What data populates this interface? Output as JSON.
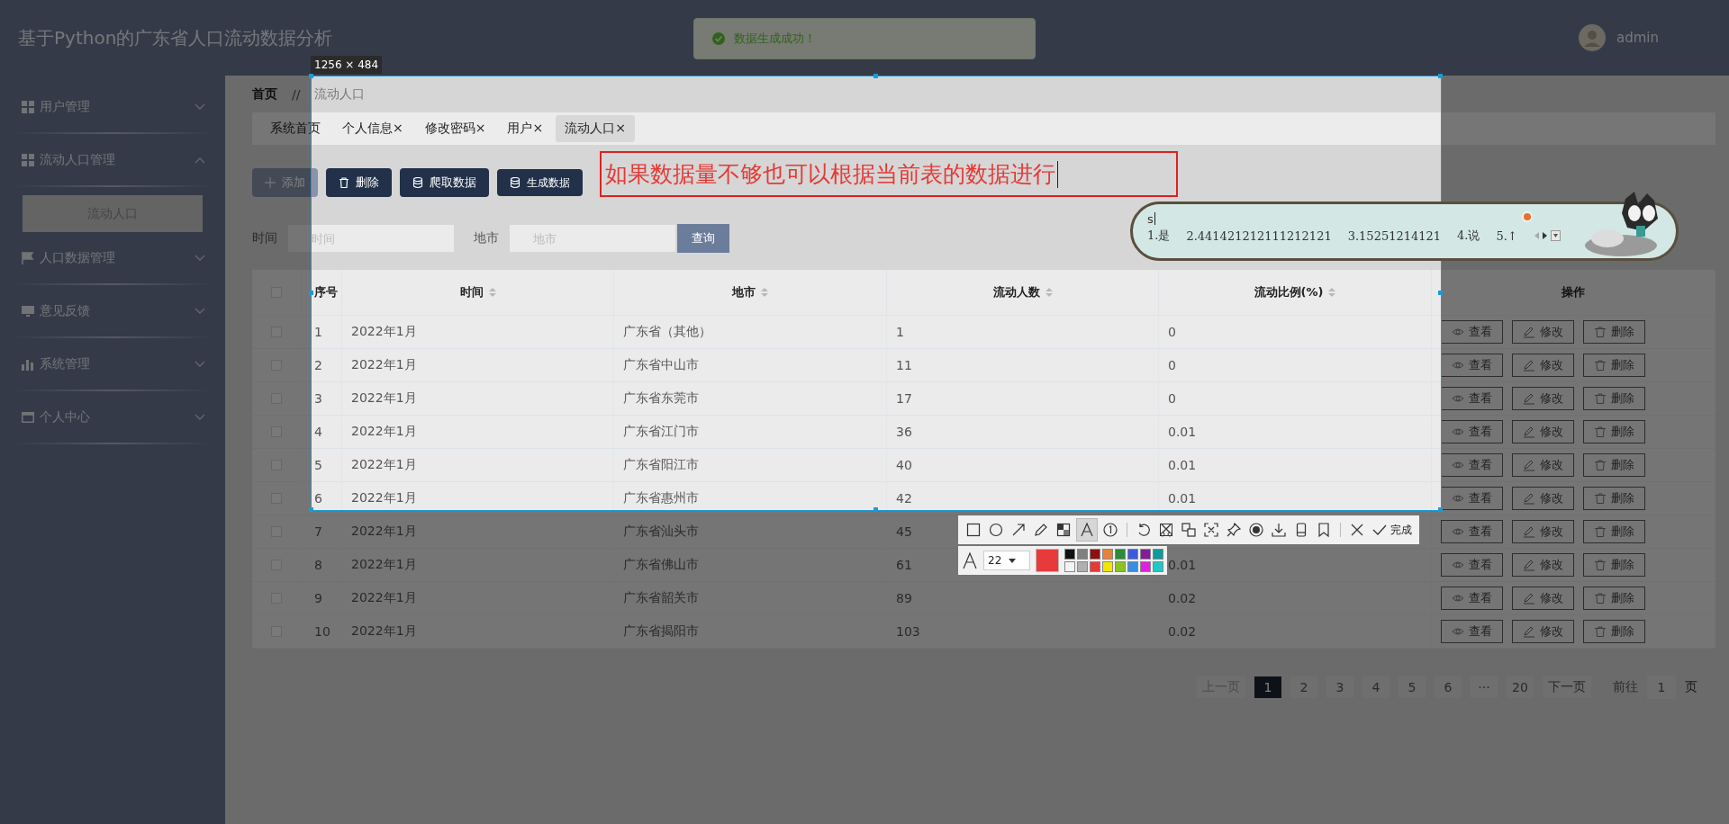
{
  "app_title": "基于Python的广东省人口流动数据分析",
  "user": {
    "name": "admin"
  },
  "toast": {
    "message": "数据生成成功！"
  },
  "sidebar": {
    "items": [
      {
        "label": "用户管理",
        "kind": "grid",
        "expanded": false
      },
      {
        "label": "流动人口管理",
        "kind": "grid",
        "expanded": true,
        "children": [
          {
            "label": "流动人口",
            "selected": true
          }
        ]
      },
      {
        "label": "人口数据管理",
        "kind": "flag",
        "expanded": false
      },
      {
        "label": "意见反馈",
        "kind": "monitor",
        "expanded": false
      },
      {
        "label": "系统管理",
        "kind": "chart",
        "expanded": false
      },
      {
        "label": "个人中心",
        "kind": "card",
        "expanded": false
      }
    ]
  },
  "breadcrumb": [
    "首页",
    "流动人口"
  ],
  "breadcrumb_separator": "//",
  "tabs": [
    {
      "label": "系统首页",
      "selected": false
    },
    {
      "label": "个人信息",
      "close": "×",
      "selected": false
    },
    {
      "label": "修改密码",
      "close": "×",
      "selected": false
    },
    {
      "label": "用户",
      "close": "×",
      "selected": false
    },
    {
      "label": "流动人口",
      "close": "×",
      "selected": true
    }
  ],
  "toolbar_buttons": [
    {
      "label": "添加",
      "kind": "add",
      "disabled": true
    },
    {
      "label": "删除",
      "kind": "delete",
      "disabled": false
    },
    {
      "label": "爬取数据",
      "kind": "database",
      "disabled": false
    },
    {
      "label": "生成数据",
      "kind": "database",
      "disabled": false
    }
  ],
  "filters": [
    {
      "label": "时间",
      "placeholder": "时间"
    },
    {
      "label": "地市",
      "placeholder": "地市"
    }
  ],
  "search_button": "查询",
  "table": {
    "columns": [
      {
        "label": "序号",
        "sortable": false
      },
      {
        "label": "时间",
        "sortable": true
      },
      {
        "label": "地市",
        "sortable": true
      },
      {
        "label": "流动人数",
        "sortable": true
      },
      {
        "label": "流动比例(%)",
        "sortable": true
      },
      {
        "label": "操作",
        "sortable": false
      }
    ],
    "header_checked": false,
    "rows": [
      {
        "checked": false,
        "cells": [
          "1",
          "2022年1月",
          "广东省（其他）",
          "1",
          "0"
        ],
        "actions": [
          "查看",
          "修改",
          "删除"
        ]
      },
      {
        "checked": false,
        "cells": [
          "2",
          "2022年1月",
          "广东省中山市",
          "11",
          "0"
        ],
        "actions": [
          "查看",
          "修改",
          "删除"
        ]
      },
      {
        "checked": false,
        "cells": [
          "3",
          "2022年1月",
          "广东省东莞市",
          "17",
          "0"
        ],
        "actions": [
          "查看",
          "修改",
          "删除"
        ]
      },
      {
        "checked": false,
        "cells": [
          "4",
          "2022年1月",
          "广东省江门市",
          "36",
          "0.01"
        ],
        "actions": [
          "查看",
          "修改",
          "删除"
        ]
      },
      {
        "checked": false,
        "cells": [
          "5",
          "2022年1月",
          "广东省阳江市",
          "40",
          "0.01"
        ],
        "actions": [
          "查看",
          "修改",
          "删除"
        ]
      },
      {
        "checked": false,
        "cells": [
          "6",
          "2022年1月",
          "广东省惠州市",
          "42",
          "0.01"
        ],
        "actions": [
          "查看",
          "修改",
          "删除"
        ]
      },
      {
        "checked": false,
        "cells": [
          "7",
          "2022年1月",
          "广东省汕头市",
          "45"
        ],
        "actions": [
          "查看",
          "修改",
          "删除"
        ]
      },
      {
        "checked": false,
        "cells": [
          "8",
          "2022年1月",
          "广东省佛山市",
          "61",
          "0.01"
        ],
        "actions": [
          "查看",
          "修改",
          "删除"
        ]
      },
      {
        "checked": false,
        "cells": [
          "9",
          "2022年1月",
          "广东省韶关市",
          "89",
          "0.02"
        ],
        "actions": [
          "查看",
          "修改",
          "删除"
        ]
      },
      {
        "checked": false,
        "cells": [
          "10",
          "2022年1月",
          "广东省揭阳市",
          "103",
          "0.02"
        ],
        "actions": [
          "查看",
          "修改",
          "删除"
        ]
      }
    ]
  },
  "pagination": {
    "prev": "上一页",
    "pages": [
      {
        "label": "1",
        "selected": true
      },
      {
        "label": "2",
        "selected": false
      },
      {
        "label": "3",
        "selected": false
      },
      {
        "label": "4",
        "selected": false
      },
      {
        "label": "5",
        "selected": false
      },
      {
        "label": "6",
        "selected": false
      },
      {
        "label": "···",
        "selected": false
      },
      {
        "label": "20",
        "selected": false
      }
    ],
    "next": "下一页",
    "goto_label": "前往",
    "goto_value": "1",
    "goto_suffix": "页"
  },
  "screenshot_tool": {
    "size_label": "1256 × 484",
    "annotation_text": "如果数据量不够也可以根据当前表的数据进行",
    "tool_groups": [
      [
        {
          "kind": "rect",
          "selected": false
        },
        {
          "kind": "ellipse",
          "selected": false
        },
        {
          "kind": "arrow",
          "selected": false
        },
        {
          "kind": "pencil",
          "selected": false
        },
        {
          "kind": "mosaic",
          "selected": false
        },
        {
          "kind": "text",
          "selected": true
        },
        {
          "kind": "number",
          "selected": false
        }
      ],
      [
        {
          "kind": "undo",
          "selected": false
        },
        {
          "kind": "cut",
          "selected": false
        },
        {
          "kind": "translate",
          "selected": false
        },
        {
          "kind": "scan",
          "selected": false
        },
        {
          "kind": "pin",
          "selected": false
        },
        {
          "kind": "record",
          "selected": false
        },
        {
          "kind": "download",
          "selected": false
        },
        {
          "kind": "phone",
          "selected": false
        },
        {
          "kind": "bookmark",
          "selected": false
        }
      ],
      [
        {
          "kind": "close",
          "selected": false
        },
        {
          "kind": "done",
          "label": "完成",
          "selected": false
        }
      ]
    ],
    "font_size": "22",
    "current_color": {
      "color": "#e83a3a"
    },
    "palette": [
      {
        "color": "#111111",
        "selected": false
      },
      {
        "color": "#808080",
        "selected": false
      },
      {
        "color": "#8b1010",
        "selected": false
      },
      {
        "color": "#e8823a",
        "selected": false
      },
      {
        "color": "#2e8b3a",
        "selected": false
      },
      {
        "color": "#3b5bdb",
        "selected": false
      },
      {
        "color": "#861a9a",
        "selected": false
      },
      {
        "color": "#109a9a",
        "selected": false
      },
      {
        "color": "#f5f5f5",
        "selected": false
      },
      {
        "color": "#b0b0b0",
        "selected": false
      },
      {
        "color": "#e53935",
        "selected": false
      },
      {
        "color": "#f2e600",
        "selected": false
      },
      {
        "color": "#8bc320",
        "selected": false
      },
      {
        "color": "#3a8de0",
        "selected": false
      },
      {
        "color": "#e020e0",
        "selected": false
      },
      {
        "color": "#20c8c8",
        "selected": false
      }
    ]
  },
  "ime": {
    "input": "s",
    "candidates": [
      "1.是",
      "2.441421212111212121",
      "3.15251214121",
      "4.说",
      "5.↑"
    ]
  }
}
